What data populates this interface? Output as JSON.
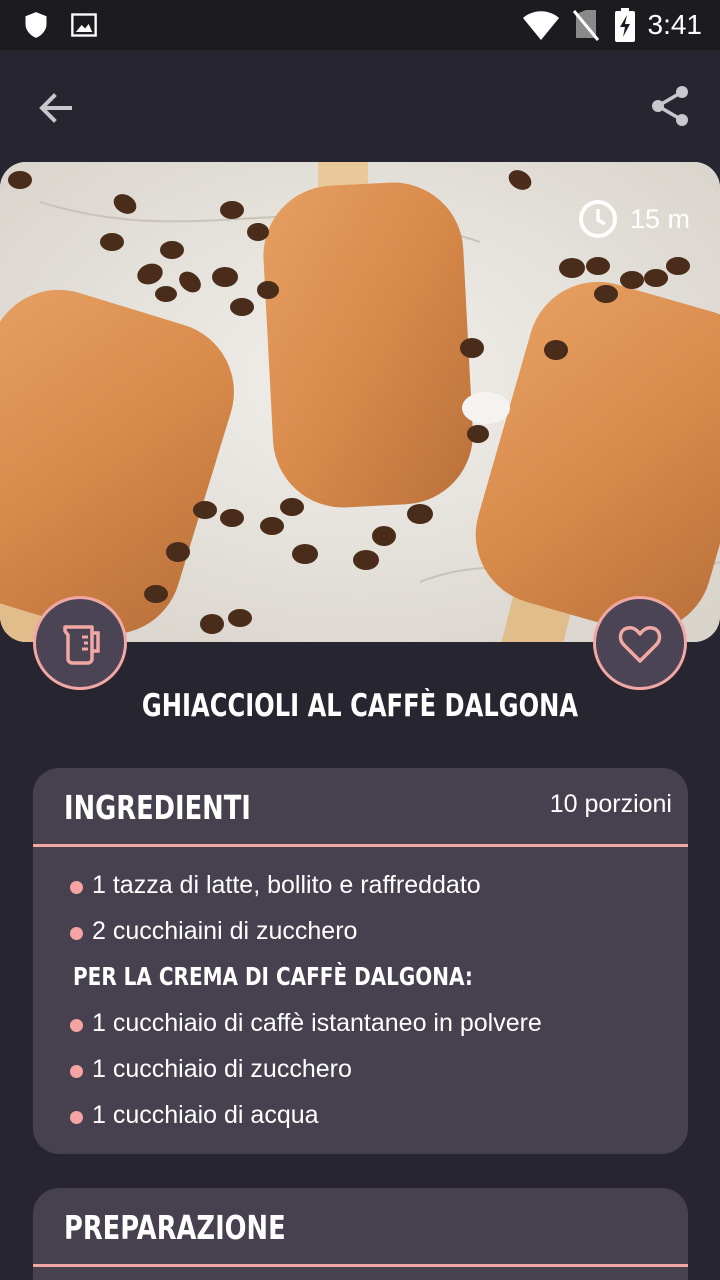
{
  "status_bar": {
    "time": "3:41",
    "left_icons": [
      "shield-icon",
      "image-icon"
    ],
    "right_icons": [
      "wifi-icon",
      "no-sim-icon",
      "battery-charging-icon"
    ]
  },
  "appbar": {
    "back_icon": "arrow-back-icon",
    "share_icon": "share-icon"
  },
  "hero": {
    "time_badge": "15 m",
    "time_icon": "clock-icon"
  },
  "actions": {
    "measure_icon": "measuring-cup-icon",
    "favorite_icon": "heart-icon"
  },
  "recipe": {
    "title": "GHIACCIOLI AL CAFFÈ DALGONA"
  },
  "ingredients": {
    "title": "INGREDIENTI",
    "servings": "10 porzioni",
    "items": [
      {
        "type": "item",
        "text": "1 tazza di latte, bollito e raffreddato"
      },
      {
        "type": "item",
        "text": "2 cucchiaini di zucchero"
      },
      {
        "type": "section",
        "text": "PER LA CREMA DI CAFFÈ DALGONA:"
      },
      {
        "type": "item",
        "text": "1 cucchiaio di caffè istantaneo in polvere"
      },
      {
        "type": "item",
        "text": "1 cucchiaio di zucchero"
      },
      {
        "type": "item",
        "text": "1 cucchiaio di acqua"
      }
    ]
  },
  "preparation": {
    "title": "PREPARAZIONE"
  },
  "colors": {
    "background": "#272530",
    "card": "#46404f",
    "accent": "#f1a8a4"
  }
}
